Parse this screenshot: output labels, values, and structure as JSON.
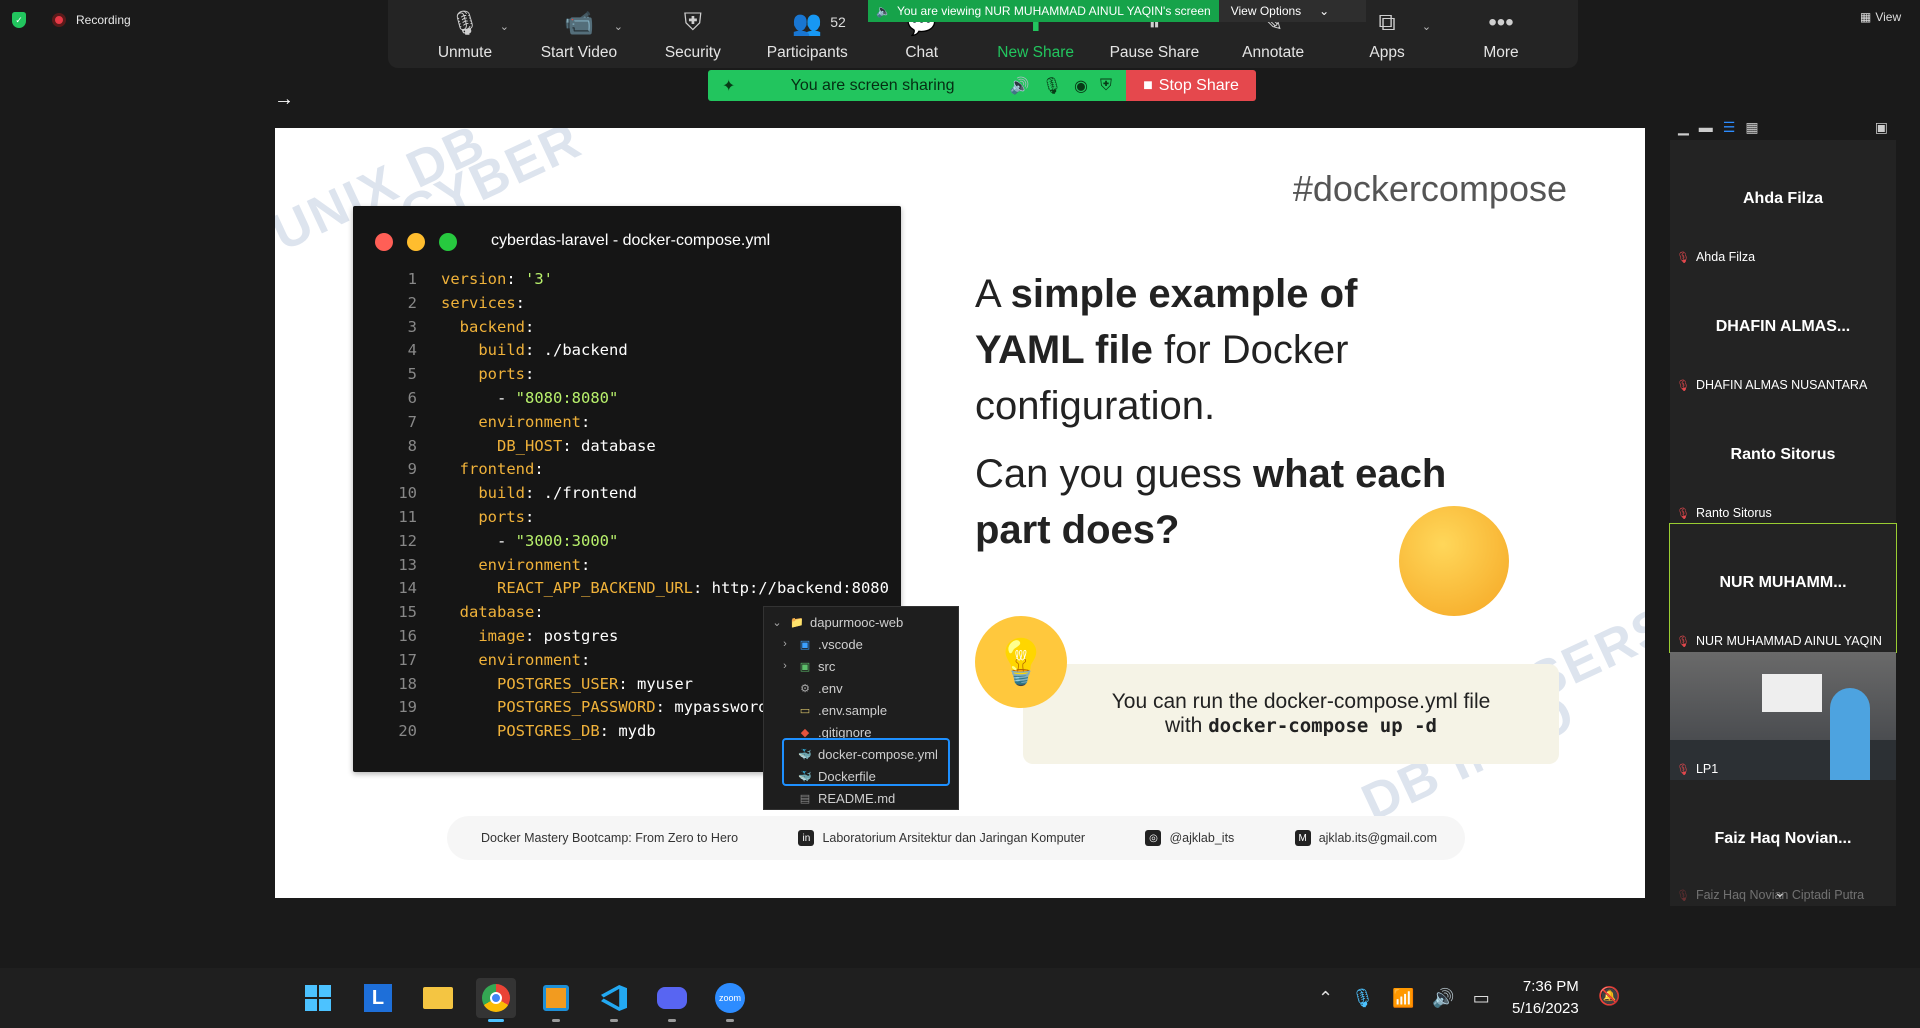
{
  "status": {
    "recording_label": "Recording"
  },
  "toolbar": {
    "items": [
      {
        "label": "Unmute",
        "icon": "mic-off-icon"
      },
      {
        "label": "Start Video",
        "icon": "video-off-icon"
      },
      {
        "label": "Security",
        "icon": "shield-icon"
      },
      {
        "label": "Participants",
        "icon": "participants-icon",
        "count": "52"
      },
      {
        "label": "Chat",
        "icon": "chat-icon"
      },
      {
        "label": "New Share",
        "icon": "share-icon"
      },
      {
        "label": "Pause Share",
        "icon": "pause-icon"
      },
      {
        "label": "Annotate",
        "icon": "pen-icon"
      },
      {
        "label": "Apps",
        "icon": "apps-icon"
      },
      {
        "label": "More",
        "icon": "more-icon"
      }
    ]
  },
  "viewing_banner": {
    "text": "You are viewing NUR MUHAMMAD AINUL YAQIN's screen",
    "options": "View Options"
  },
  "share_bar": {
    "text": "You are screen sharing",
    "stop": "Stop Share"
  },
  "slide": {
    "hashtag": "#dockercompose",
    "code_title": "cyberdas-laravel - docker-compose.yml",
    "code_lines": [
      {
        "n": "1",
        "indent": "",
        "key": "version",
        "val": "'3'",
        "str": true
      },
      {
        "n": "2",
        "indent": "",
        "key": "services",
        "val": "",
        "str": false
      },
      {
        "n": "3",
        "indent": "  ",
        "key": "backend",
        "val": "",
        "str": false
      },
      {
        "n": "4",
        "indent": "    ",
        "key": "build",
        "val": "./backend",
        "str": false
      },
      {
        "n": "5",
        "indent": "    ",
        "key": "ports",
        "val": "",
        "str": false
      },
      {
        "n": "6",
        "indent": "      ",
        "key": "",
        "val": "\"8080:8080\"",
        "str": true
      },
      {
        "n": "7",
        "indent": "    ",
        "key": "environment",
        "val": "",
        "str": false
      },
      {
        "n": "8",
        "indent": "      ",
        "key": "DB_HOST",
        "val": "database",
        "str": false
      },
      {
        "n": "9",
        "indent": "  ",
        "key": "frontend",
        "val": "",
        "str": false
      },
      {
        "n": "10",
        "indent": "    ",
        "key": "build",
        "val": "./frontend",
        "str": false
      },
      {
        "n": "11",
        "indent": "    ",
        "key": "ports",
        "val": "",
        "str": false
      },
      {
        "n": "12",
        "indent": "      ",
        "key": "",
        "val": "\"3000:3000\"",
        "str": true
      },
      {
        "n": "13",
        "indent": "    ",
        "key": "environment",
        "val": "",
        "str": false
      },
      {
        "n": "14",
        "indent": "      ",
        "key": "REACT_APP_BACKEND_URL",
        "val": "http://backend:8080",
        "str": false
      },
      {
        "n": "15",
        "indent": "  ",
        "key": "database",
        "val": "",
        "str": false
      },
      {
        "n": "16",
        "indent": "    ",
        "key": "image",
        "val": "postgres",
        "str": false
      },
      {
        "n": "17",
        "indent": "    ",
        "key": "environment",
        "val": "",
        "str": false
      },
      {
        "n": "18",
        "indent": "      ",
        "key": "POSTGRES_USER",
        "val": "myuser",
        "str": false
      },
      {
        "n": "19",
        "indent": "      ",
        "key": "POSTGRES_PASSWORD",
        "val": "mypassword",
        "str": false
      },
      {
        "n": "20",
        "indent": "      ",
        "key": "POSTGRES_DB",
        "val": "mydb",
        "str": false
      }
    ],
    "file_tree": [
      {
        "name": "dapurmooc-web",
        "icon": "folder-icon",
        "caret": "⌄"
      },
      {
        "name": ".vscode",
        "icon": "vscode-folder-icon",
        "caret": "›"
      },
      {
        "name": "src",
        "icon": "src-folder-icon",
        "caret": "›"
      },
      {
        "name": ".env",
        "icon": "gear-icon",
        "caret": ""
      },
      {
        "name": ".env.sample",
        "icon": "file-icon",
        "caret": ""
      },
      {
        "name": ".gitignore",
        "icon": "git-icon",
        "caret": ""
      },
      {
        "name": "docker-compose.yml",
        "icon": "docker-icon",
        "caret": ""
      },
      {
        "name": "Dockerfile",
        "icon": "docker-icon",
        "caret": ""
      },
      {
        "name": "README.md",
        "icon": "markdown-icon",
        "caret": ""
      }
    ],
    "headline_pre": "A ",
    "headline_bold": "simple example of YAML file",
    "headline_post": " for Docker configuration.",
    "question_pre": "Can you guess ",
    "question_bold": "what each part does?",
    "tip_line1": "You can run the docker-compose.yml file",
    "tip_with": "with ",
    "tip_cmd": "docker-compose up -d",
    "footer": {
      "course": "Docker Mastery Bootcamp: From Zero to Hero",
      "linkedin": "Laboratorium Arsitektur dan Jaringan Komputer",
      "instagram": "@ajklab_its",
      "email": "ajklab.its@gmail.com"
    }
  },
  "right_panel": {
    "view_label": "View",
    "participants": [
      {
        "big": "Ahda Filza",
        "small": "Ahda Filza"
      },
      {
        "big": "DHAFIN ALMAS...",
        "small": "DHAFIN ALMAS NUSANTARA"
      },
      {
        "big": "Ranto Sitorus",
        "small": "Ranto Sitorus"
      },
      {
        "big": "NUR  MUHAMM...",
        "small": "NUR MUHAMMAD AINUL YAQIN"
      },
      {
        "big": "",
        "small": "LP1"
      },
      {
        "big": "Faiz Haq  Novian...",
        "small": "Faiz Haq Novian Ciptadi Putra"
      }
    ]
  },
  "taskbar": {
    "apps": [
      "windows-start-icon",
      "lasso-icon",
      "file-explorer-icon",
      "chrome-icon",
      "virtualbox-icon",
      "vscode-icon",
      "discord-icon",
      "zoom-icon"
    ],
    "time": "7:36 PM",
    "date": "5/16/2023"
  },
  "colors": {
    "share_green": "#22c55e",
    "stop_red": "#e5484d",
    "zoom_blue": "#2d8cff"
  }
}
